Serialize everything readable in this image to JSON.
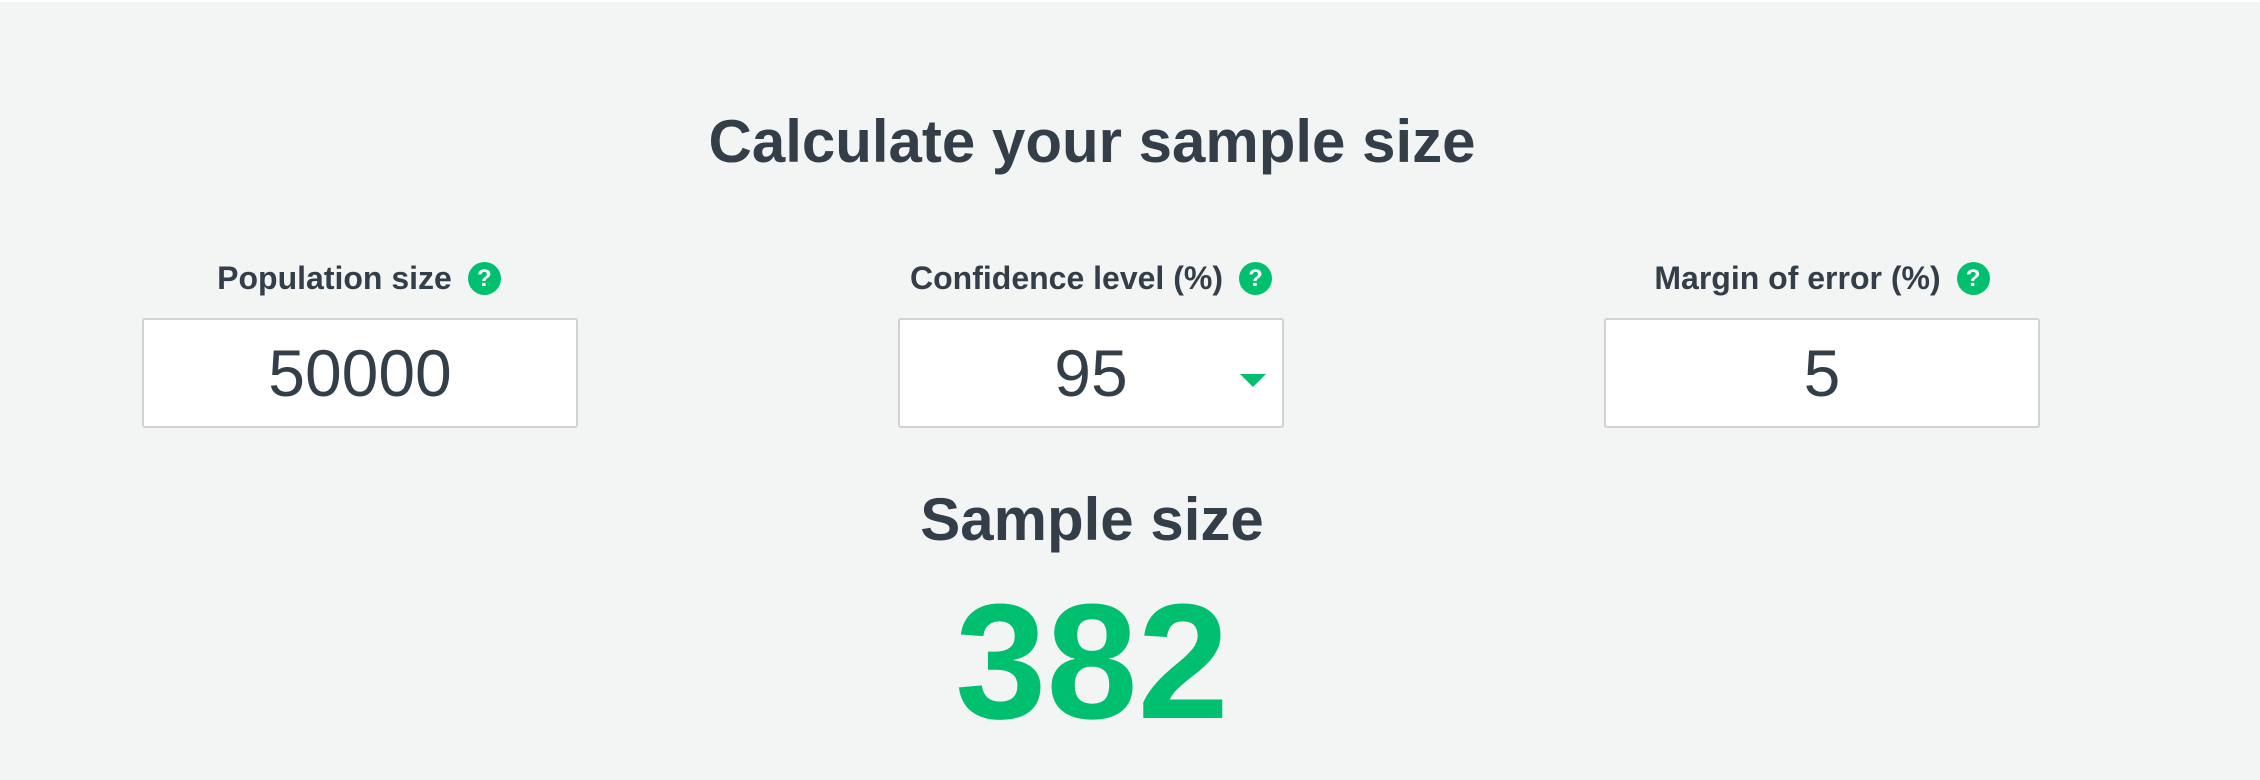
{
  "calculator": {
    "title": "Calculate your sample size",
    "fields": [
      {
        "label": "Population size",
        "value": "50000",
        "help_icon": "question-mark-icon"
      },
      {
        "label": "Confidence level (%)",
        "value": "95",
        "help_icon": "question-mark-icon",
        "dropdown_icon": "caret-down-icon"
      },
      {
        "label": "Margin of error (%)",
        "value": "5",
        "help_icon": "question-mark-icon"
      }
    ],
    "help_glyph": "?",
    "result": {
      "label": "Sample size",
      "value": "382"
    }
  },
  "colors": {
    "background": "#f3f5f4",
    "text": "#333e48",
    "accent": "#00bf6f",
    "input_border": "#d0d2d3"
  }
}
